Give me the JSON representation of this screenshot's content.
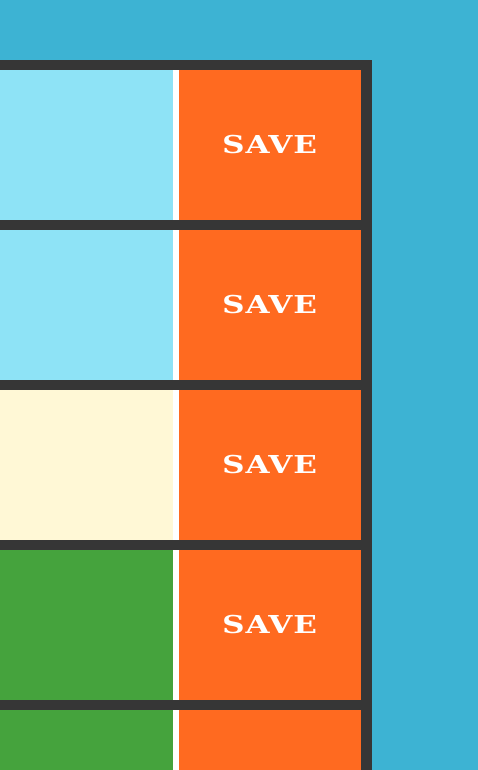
{
  "colors": {
    "page_background": "#3db3d3",
    "panel_frame": "#363636",
    "save_button": "#ff6a20",
    "save_text": "#ffffff",
    "divider": "#ffffff"
  },
  "rows": [
    {
      "swatch_color": "#8ee3f6",
      "save_label": "SAVE"
    },
    {
      "swatch_color": "#8ee3f6",
      "save_label": "SAVE"
    },
    {
      "swatch_color": "#fff8d6",
      "save_label": "SAVE"
    },
    {
      "swatch_color": "#45a33d",
      "save_label": "SAVE"
    },
    {
      "swatch_color": "#45a33d",
      "save_label": ""
    }
  ]
}
